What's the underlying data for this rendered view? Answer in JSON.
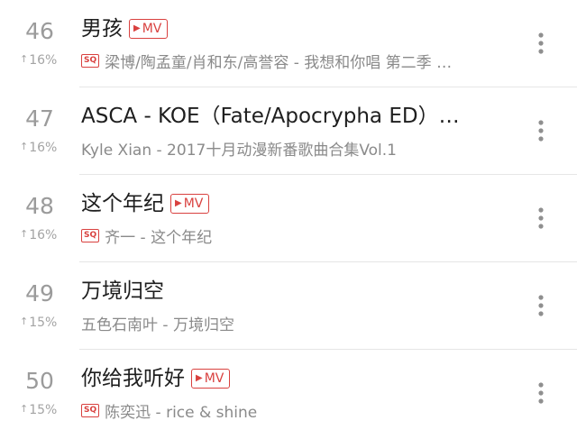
{
  "colors": {
    "accent_red": "#d9413f",
    "text_primary": "#1e1e1e",
    "text_secondary": "#8a8a8a",
    "rank_gray": "#9b9b9b",
    "divider": "#e6e6e6"
  },
  "icons": {
    "mv": "play-triangle-icon",
    "quality": "sq-badge-icon",
    "more": "vertical-dots-icon",
    "trend": "arrow-up-icon"
  },
  "songs": [
    {
      "rank": "46",
      "trend_arrow": "↑",
      "trend": "16%",
      "title": "男孩",
      "has_mv": true,
      "mv_label": "MV",
      "has_sq": true,
      "sq_label": "SQ",
      "subtitle": "梁博/陶孟童/肖和东/高誉容 - 我想和你唱 第二季 …"
    },
    {
      "rank": "47",
      "trend_arrow": "↑",
      "trend": "16%",
      "title": "ASCA - KOE（Fate/Apocrypha ED）…",
      "has_mv": false,
      "mv_label": "",
      "has_sq": false,
      "sq_label": "",
      "subtitle": "Kyle Xian - 2017十月动漫新番歌曲合集Vol.1"
    },
    {
      "rank": "48",
      "trend_arrow": "↑",
      "trend": "16%",
      "title": "这个年纪",
      "has_mv": true,
      "mv_label": "MV",
      "has_sq": true,
      "sq_label": "SQ",
      "subtitle": "齐一 - 这个年纪"
    },
    {
      "rank": "49",
      "trend_arrow": "↑",
      "trend": "15%",
      "title": "万境归空",
      "has_mv": false,
      "mv_label": "",
      "has_sq": false,
      "sq_label": "",
      "subtitle": "五色石南叶 - 万境归空"
    },
    {
      "rank": "50",
      "trend_arrow": "↑",
      "trend": "15%",
      "title": "你给我听好",
      "has_mv": true,
      "mv_label": "MV",
      "has_sq": true,
      "sq_label": "SQ",
      "subtitle": "陈奕迅 - rice & shine"
    }
  ]
}
